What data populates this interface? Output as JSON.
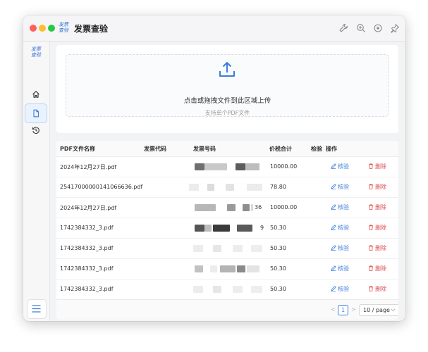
{
  "app": {
    "title": "发票查验",
    "logo_text": "发票查验"
  },
  "upload": {
    "main_text": "点击或拖拽文件到此区域上传",
    "hint": "支持单个PDF文件"
  },
  "table": {
    "columns": [
      "PDF文件名称",
      "发票代码",
      "发票号码",
      "价税合计",
      "检验",
      "操作"
    ],
    "rows": [
      {
        "file": "2024年12月27日.pdf",
        "number_tail": "",
        "amount": "10000.00"
      },
      {
        "file": "25417000000141066636.pdf",
        "number_tail": "",
        "amount": "78.80"
      },
      {
        "file": "2024年12月27日.pdf",
        "number_tail": "36",
        "amount": "10000.00"
      },
      {
        "file": "1742384332_3.pdf",
        "number_tail": "9",
        "amount": "50.30"
      },
      {
        "file": "1742384332_3.pdf",
        "number_tail": "",
        "amount": "50.30"
      },
      {
        "file": "1742384332_3.pdf",
        "number_tail": "",
        "amount": "50.30"
      },
      {
        "file": "1742384332_3.pdf",
        "number_tail": "",
        "amount": "50.30"
      }
    ],
    "actions": {
      "verify": "核验",
      "delete": "删除"
    }
  },
  "pagination": {
    "prev": "<",
    "current": "1",
    "next": ">",
    "page_size": "10 / page"
  },
  "colors": {
    "accent": "#3b7ddd",
    "danger": "#e04b4b"
  }
}
